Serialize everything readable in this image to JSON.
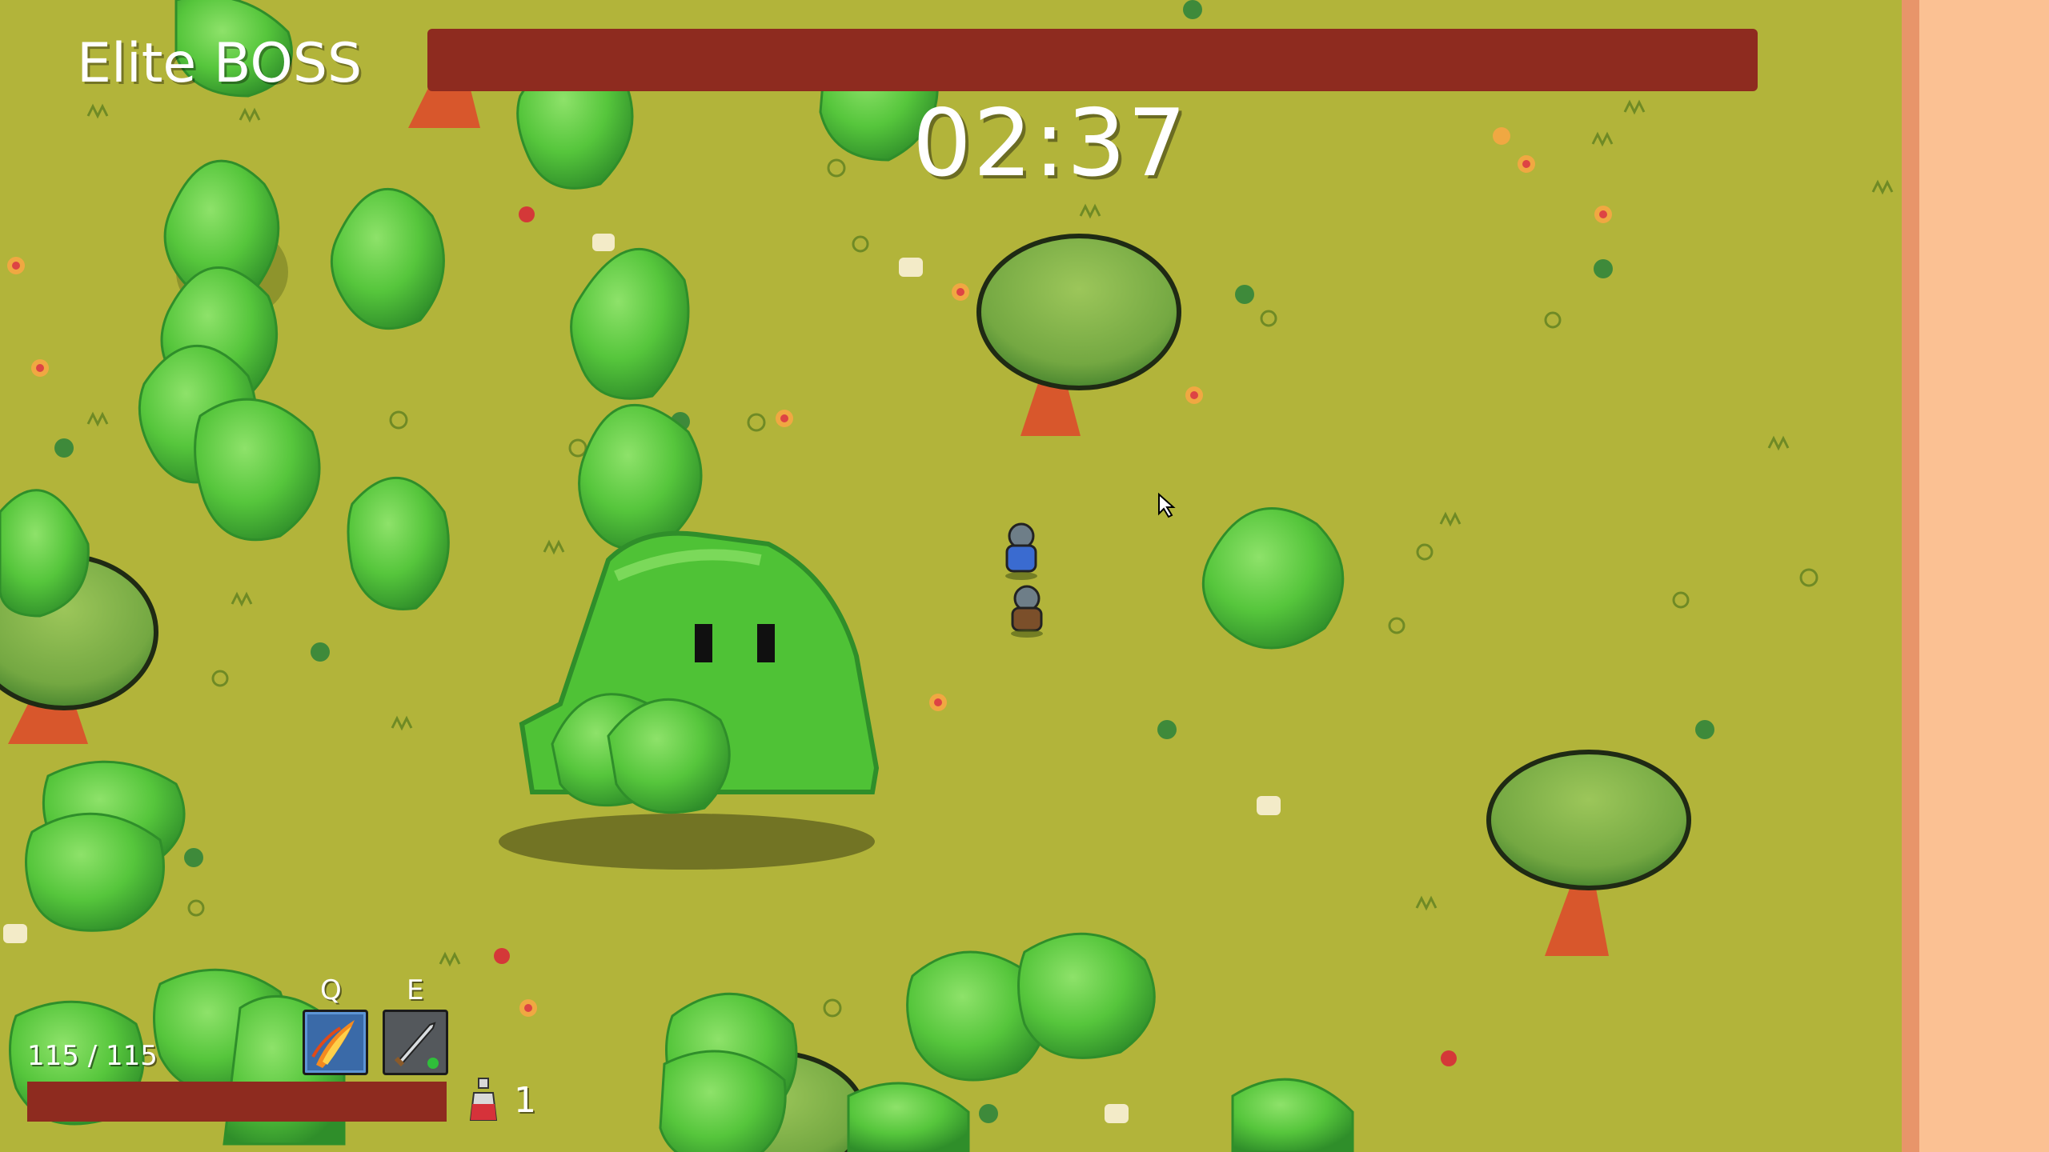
{
  "hud": {
    "boss_title": "Elite BOSS",
    "timer": "02:37",
    "player_hp": "115 / 115",
    "hotkeys": {
      "q": "Q",
      "e": "E"
    },
    "potion_count": "1"
  },
  "abilities": [
    {
      "key": "Q",
      "icon": "fire-slash-icon"
    },
    {
      "key": "E",
      "icon": "sword-icon"
    }
  ],
  "colors": {
    "grass": "#b2b43a",
    "boss_bar": "#8e2b1f",
    "player_bar": "#8e2b1f",
    "slime": "#55c93a",
    "bush": "#58c83e",
    "wall": "#e8956a"
  }
}
